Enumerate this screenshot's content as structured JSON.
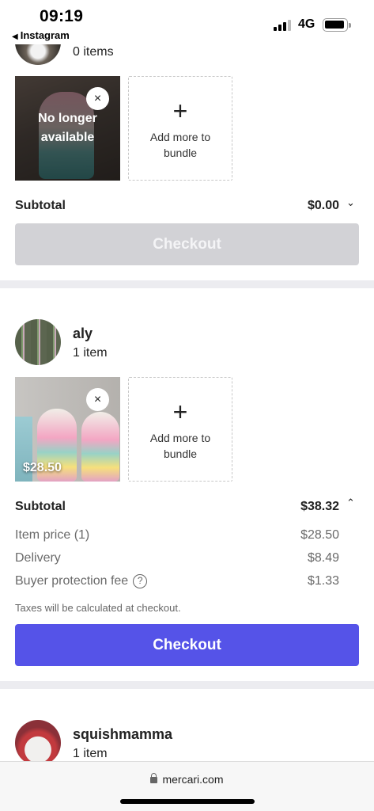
{
  "status_bar": {
    "time": "09:19",
    "back_app": "Instagram",
    "back_arrow": "◀",
    "network": "4G",
    "signal_icon": "signal-bars-icon",
    "battery_icon": "battery-icon"
  },
  "sellers": [
    {
      "name": "",
      "count": "0 items",
      "item": {
        "status": "No longer available",
        "close_icon": "×"
      },
      "add_more": {
        "plus": "+",
        "label": "Add more to bundle"
      },
      "subtotal_label": "Subtotal",
      "subtotal": "$0.00",
      "chevron": "⌄",
      "checkout": "Checkout",
      "checkout_enabled": false
    },
    {
      "name": "aly",
      "count": "1 item",
      "item": {
        "price": "$28.50",
        "close_icon": "×"
      },
      "add_more": {
        "plus": "+",
        "label": "Add more to bundle"
      },
      "subtotal_label": "Subtotal",
      "subtotal": "$38.32",
      "chevron": "⌃",
      "breakdown": [
        {
          "label": "Item price (1)",
          "value": "$28.50"
        },
        {
          "label": "Delivery",
          "value": "$8.49"
        },
        {
          "label": "Buyer protection fee",
          "value": "$1.33",
          "help_icon": "?"
        }
      ],
      "tax_note": "Taxes will be calculated at checkout.",
      "checkout": "Checkout",
      "checkout_enabled": true
    },
    {
      "name": "squishmamma",
      "count": "1 item"
    }
  ],
  "browser": {
    "url": "mercari.com"
  },
  "colors": {
    "accent": "#5553e8",
    "disabled": "#d2d2d6",
    "divider": "#ececf0"
  }
}
